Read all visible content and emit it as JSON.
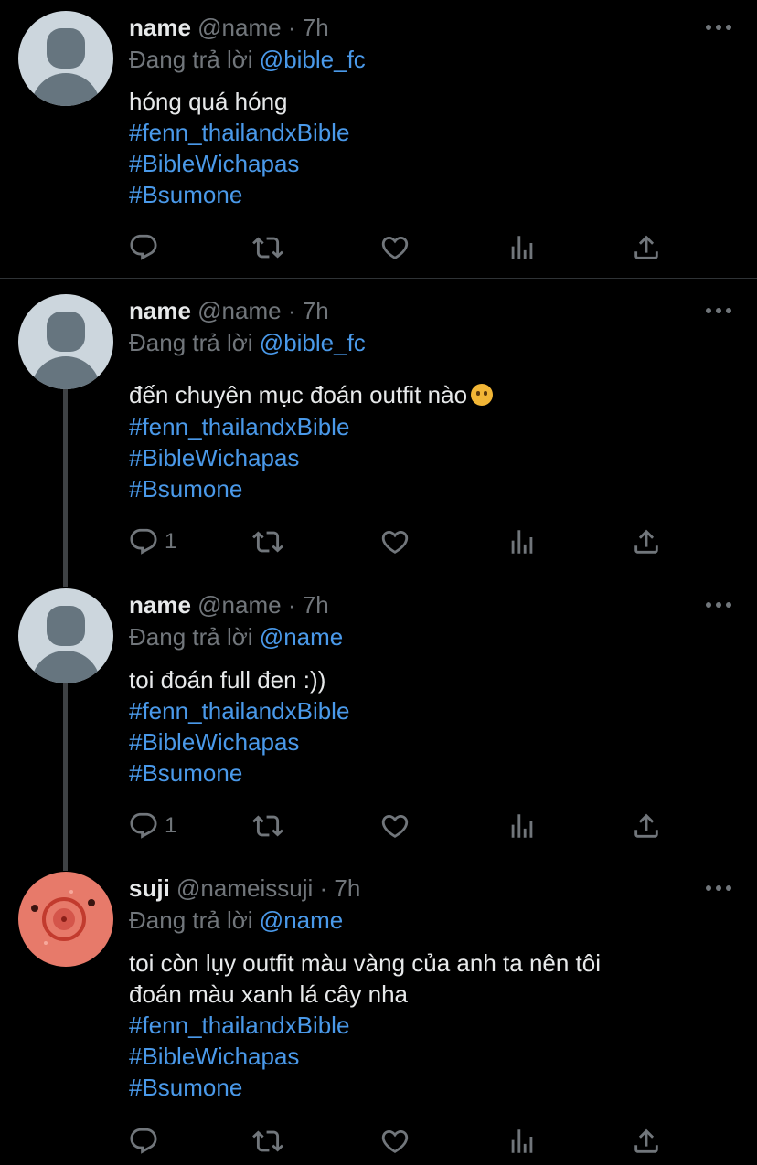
{
  "reply_prefix": "Đang trả lời",
  "tweets": [
    {
      "display_name": "name",
      "handle": "@name",
      "dot": "·",
      "time": "7h",
      "reply_to": "@bible_fc",
      "text_lines": [
        "hóng quá hóng"
      ],
      "hashtags": [
        "#fenn_thailandxBible",
        "#BibleWichapas",
        "#Bsumone"
      ],
      "reply_count": "",
      "avatar_icon": "default-avatar-icon"
    },
    {
      "display_name": "name",
      "handle": "@name",
      "dot": "·",
      "time": "7h",
      "reply_to": "@bible_fc",
      "text_lines": [
        "đến chuyên mục đoán outfit nào"
      ],
      "emoji": "thinking-face-emoji",
      "hashtags": [
        "#fenn_thailandxBible",
        "#BibleWichapas",
        "#Bsumone"
      ],
      "reply_count": "1",
      "avatar_icon": "default-avatar-icon"
    },
    {
      "display_name": "name",
      "handle": "@name",
      "dot": "·",
      "time": "7h",
      "reply_to": "@name",
      "text_lines": [
        "toi đoán full đen :))"
      ],
      "hashtags": [
        "#fenn_thailandxBible",
        "#BibleWichapas",
        "#Bsumone"
      ],
      "reply_count": "1",
      "avatar_icon": "default-avatar-icon"
    },
    {
      "display_name": "suji",
      "handle": "@nameissuji",
      "dot": "·",
      "time": "7h",
      "reply_to": "@name",
      "text_lines": [
        "toi còn lụy outfit màu vàng của anh ta nên tôi",
        "đoán màu xanh lá cây nha"
      ],
      "hashtags": [
        "#fenn_thailandxBible",
        "#BibleWichapas",
        "#Bsumone"
      ],
      "reply_count": "",
      "avatar_icon": "pig-avatar-icon"
    }
  ],
  "colors": {
    "background": "#000000",
    "text": "#e7e9ea",
    "muted": "#71767b",
    "link": "#4a99e9",
    "divider": "#2f3336"
  }
}
